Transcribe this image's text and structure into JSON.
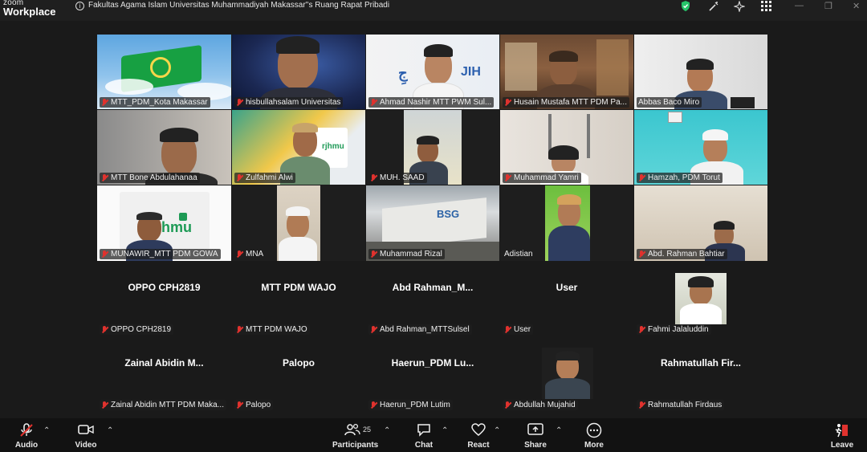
{
  "app": {
    "logo_line1": "zoom",
    "logo_line2": "Workplace"
  },
  "meeting_title": "Fakultas Agama Islam Universitas Muhammadiyah Makassar''s Ruang Rapat Pribadi",
  "icons": [
    "info-icon",
    "shield-icon",
    "apps-icon",
    "grid-icon",
    "minimize-icon",
    "restore-icon",
    "close-icon",
    "mic-muted-icon"
  ],
  "participants": [
    "MTT_PDM_Kota Makassar",
    "hisbullahsalam Universitas",
    "Ahmad Nashir MTT PWM Sul...",
    "Husain Mustafa MTT PDM Pa...",
    "Abbas Baco Miro",
    "MTT Bone Abdulahanaa",
    "Zulfahmi Alwi",
    "MUH. SAAD",
    "Muhammad Yamri",
    "Hamzah, PDM Torut",
    "MUNAWIR_MTT PDM GOWA",
    "MNA",
    "Muhammad Rizal",
    "Adistian",
    "Abd. Rahman Bahtiar"
  ],
  "name_tiles": [
    {
      "display": "OPPO CPH2819",
      "label": "OPPO CPH2819"
    },
    {
      "display": "MTT PDM WAJO",
      "label": "MTT PDM WAJO"
    },
    {
      "display": "Abd  Rahman_M...",
      "label": "Abd Rahman_MTTSulsel"
    },
    {
      "display": "User",
      "label": "User"
    },
    {
      "display": "",
      "label": "Fahmi Jalaluddin"
    },
    {
      "display": "Zainal  Abidin  M...",
      "label": "Zainal Abidin MTT PDM Maka..."
    },
    {
      "display": "Palopo",
      "label": "Palopo"
    },
    {
      "display": "Haerun_PDM  Lu...",
      "label": "Haerun_PDM Lutim"
    },
    {
      "display": "",
      "label": "Abdullah Mujahid"
    },
    {
      "display": "Rahmatullah  Fir...",
      "label": "Rahmatullah Firdaus"
    }
  ],
  "toolbar": {
    "audio": "Audio",
    "video": "Video",
    "participants": "Participants",
    "participants_count": "25",
    "chat": "Chat",
    "react": "React",
    "share": "Share",
    "more": "More",
    "leave": "Leave"
  },
  "colors": {
    "active_speaker": "#3bd16f",
    "muted": "#e0322e",
    "secure": "#27c46a"
  }
}
